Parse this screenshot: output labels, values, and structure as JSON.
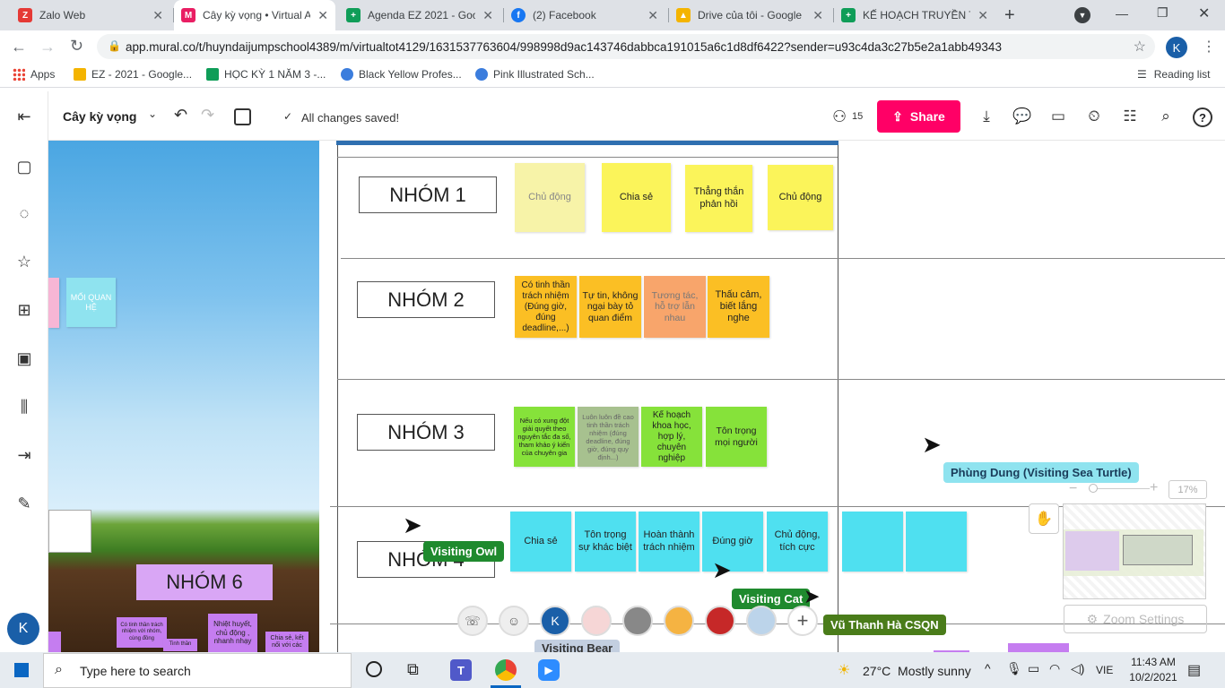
{
  "browser": {
    "tabs": [
      {
        "title": "Zalo Web",
        "color": "#e53935"
      },
      {
        "title": "Cây kỳ vọng • Virtual A",
        "color": "#e91e63"
      },
      {
        "title": "Agenda EZ 2021 - Goo",
        "color": "#0f9d58"
      },
      {
        "title": "(2) Facebook",
        "color": "#1877f2"
      },
      {
        "title": "Drive của tôi - Google",
        "color": "#f4b400"
      },
      {
        "title": "KẾ HOẠCH TRUYỀN TH",
        "color": "#0f9d58"
      }
    ],
    "new_tab": "+",
    "url": "app.mural.co/t/huyndaijumpschool4389/m/virtualtot4129/1631537763604/998998d9ac143746dabbca191015a6c1d8df6422?sender=u93c4da3c27b5e2a1abb49343",
    "profile_initial": "K",
    "bookmarks": [
      "Apps",
      "EZ - 2021 - Google...",
      "HỌC KỲ 1 NĂM 3 -...",
      "Black Yellow Profes...",
      "Pink Illustrated Sch..."
    ],
    "reading_list": "Reading list"
  },
  "mural": {
    "title": "Cây kỳ vọng",
    "saved_status": "All changes saved!",
    "participants": "15",
    "share": "Share",
    "zoom": "17%",
    "zoom_settings": "Zoom Settings",
    "groups": [
      {
        "name": "NHÓM 1",
        "notes": [
          "Chủ động",
          "Chia sẻ",
          "Thẳng thắn phản hồi",
          "Chủ động"
        ]
      },
      {
        "name": "NHÓM 2",
        "notes": [
          "Có tinh thần trách nhiệm (Đúng giờ, đúng deadline,...)",
          "Tự tin, không ngại bày tỏ quan điểm",
          "Tương tác, hỗ trợ lẫn nhau",
          "Thấu cảm, biết lắng nghe"
        ]
      },
      {
        "name": "NHÓM 3",
        "notes": [
          "Nếu có xung đột giải quyết theo nguyên tắc đa số, tham khảo ý kiến của chuyên gia",
          "Luôn luôn đề cao tinh thần trách nhiệm (đúng deadline, đúng giờ, đúng quy định...)",
          "Kế hoạch khoa học, hợp lý, chuyên nghiệp",
          "Tôn trọng mọi người"
        ]
      },
      {
        "name": "NHÓM 4",
        "notes": [
          "Chia sẻ",
          "Tôn trọng sự khác biệt",
          "Hoàn thành trách nhiệm",
          "Đúng giờ",
          "Chủ động, tích cực",
          "",
          ""
        ]
      }
    ],
    "left_panel": {
      "note_moi": "MỐI QUAN HỆ",
      "group6": "NHÓM 6",
      "small_notes": [
        "Có tinh thần trách nhiệm với nhóm, cùng đồng",
        "Tinh thần",
        "Nhiệt huyết, chủ động , nhanh nhạy",
        "Chia sẻ, kết nối với các"
      ]
    },
    "visitors": [
      "Phùng Dung (Visiting Sea Turtle)",
      "Visiting Owl",
      "Visiting Cat",
      "Vũ Thanh Hà CSQN",
      "Visiting Bear"
    ],
    "self_initial": "K"
  },
  "taskbar": {
    "search_placeholder": "Type here to search",
    "weather": "27°C  Mostly sunny",
    "lang": "VIE",
    "time": "11:43 AM",
    "date": "10/2/2021"
  }
}
